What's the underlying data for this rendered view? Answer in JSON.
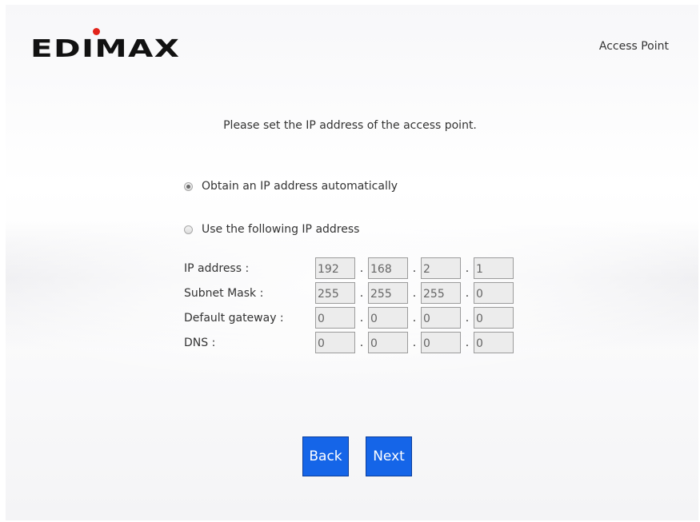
{
  "brand": {
    "logo_text": "EDIMAX",
    "accent_color": "#e2231a"
  },
  "header": {
    "mode": "Access Point"
  },
  "instruction": "Please set the IP address of the access point.",
  "options": {
    "auto": {
      "label": "Obtain an IP address automatically",
      "selected": true
    },
    "manual": {
      "label": "Use the following IP address",
      "selected": false
    }
  },
  "fields": [
    {
      "label": "IP address :",
      "octets": [
        "192",
        "168",
        "2",
        "1"
      ]
    },
    {
      "label": "Subnet Mask :",
      "octets": [
        "255",
        "255",
        "255",
        "0"
      ]
    },
    {
      "label": "Default gateway :",
      "octets": [
        "0",
        "0",
        "0",
        "0"
      ]
    },
    {
      "label": "DNS :",
      "octets": [
        "0",
        "0",
        "0",
        "0"
      ]
    }
  ],
  "separator": ".",
  "buttons": {
    "back": "Back",
    "next": "Next",
    "color": "#1565e8"
  }
}
